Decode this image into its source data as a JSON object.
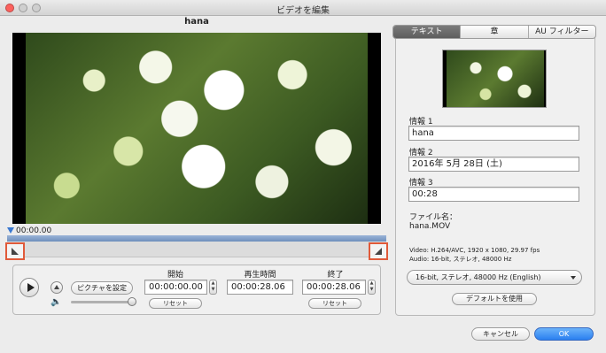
{
  "window": {
    "title": "ビデオを編集"
  },
  "video": {
    "title": "hana",
    "current_time": "00:00.00"
  },
  "trim": {
    "play_label": "",
    "picture_button": "ピクチャを設定",
    "start_label": "開始",
    "start_value": "00:00:00.00",
    "start_reset": "リセット",
    "duration_label": "再生時間",
    "duration_value": "00:00:28.06",
    "end_label": "終了",
    "end_value": "00:00:28.06",
    "end_reset": "リセット"
  },
  "tabs": [
    {
      "label": "テキスト",
      "active": true
    },
    {
      "label": "章",
      "active": false
    },
    {
      "label": "AU フィルター",
      "active": false
    }
  ],
  "info": {
    "label1": "情報 1",
    "value1": "hana",
    "label2": "情報 2",
    "value2": "2016年 5月 28日 (土)",
    "label3": "情報 3",
    "value3": "00:28",
    "filename_label": "ファイル名：",
    "filename_value": "hana.MOV",
    "video_spec": "Video: H.264/AVC, 1920 x 1080, 29.97 fps",
    "audio_spec": "Audio: 16-bit, ステレオ, 48000 Hz",
    "audio_select": "16-bit, ステレオ, 48000 Hz (English)",
    "default_button": "デフォルトを使用"
  },
  "footer": {
    "cancel": "キャンセル",
    "ok": "OK"
  },
  "colors": {
    "marker_highlight": "#e05a3a",
    "track": "#7f9cc8",
    "ok_button": "#2a7ff0"
  }
}
